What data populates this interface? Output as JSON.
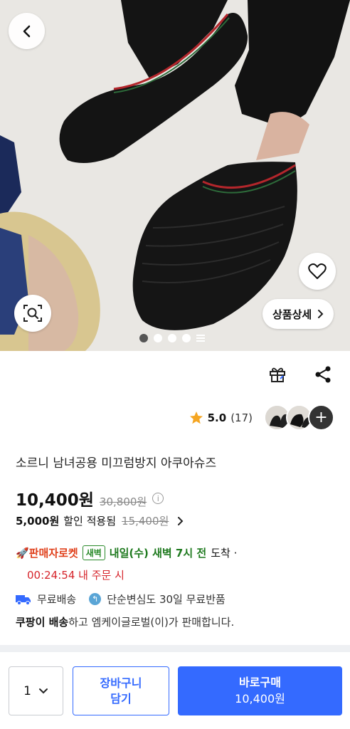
{
  "hero": {
    "detail_button_label": "상품상세",
    "image_count_visible": 4,
    "active_image_index": 0
  },
  "review": {
    "score": "5.0",
    "count": "(17)",
    "more_symbol": "+"
  },
  "product": {
    "title": "소르니 남녀공용 미끄럼방지 아쿠아슈즈",
    "price": "10,400원",
    "original_price": "30,800원",
    "discount_amount": "5,000원",
    "discount_text": "할인 적용됨",
    "discount_original": "15,400원"
  },
  "delivery": {
    "rocket_label": "🚀판매자로켓",
    "dawn_badge": "새벽",
    "arrival_text": "내일(수) 새벽 7시 전",
    "arrival_suffix": "도착 ·",
    "countdown": "00:24:54 내 주문 시",
    "free_shipping": "무료배송",
    "free_return": "단순변심도 30일 무료반품"
  },
  "seller": {
    "shipper": "쿠팡이 배송",
    "text": "하고 엠케이글로벌(이)가 판매합니다."
  },
  "bottom_bar": {
    "quantity": "1",
    "cart_line1": "장바구니",
    "cart_line2": "담기",
    "buy_line1": "바로구매",
    "buy_line2": "10,400원"
  },
  "colors": {
    "accent": "#346aff",
    "rocket": "#e0401b",
    "dawn_green": "#1f7a1f",
    "countdown_red": "#d6242b"
  },
  "icons": [
    "back-arrow-icon",
    "heart-icon",
    "lens-search-icon",
    "chevron-right-icon",
    "gift-icon",
    "share-icon",
    "star-icon",
    "info-icon",
    "truck-icon",
    "return-icon",
    "chevron-down-icon"
  ]
}
